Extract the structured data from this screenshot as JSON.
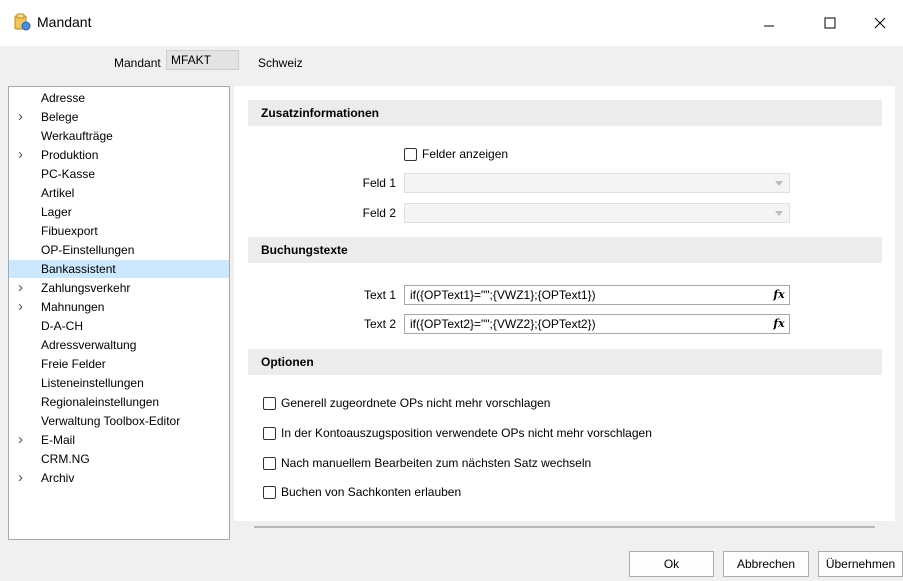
{
  "window": {
    "title": "Mandant"
  },
  "header": {
    "mandant_label": "Mandant",
    "mandant_code": "MFAKT",
    "mandant_name": "Schweiz"
  },
  "tree": {
    "items": [
      {
        "label": "Adresse",
        "expandable": false,
        "selected": false
      },
      {
        "label": "Belege",
        "expandable": true,
        "selected": false
      },
      {
        "label": "Werkaufträge",
        "expandable": false,
        "selected": false
      },
      {
        "label": "Produktion",
        "expandable": true,
        "selected": false
      },
      {
        "label": "PC-Kasse",
        "expandable": false,
        "selected": false
      },
      {
        "label": "Artikel",
        "expandable": false,
        "selected": false
      },
      {
        "label": "Lager",
        "expandable": false,
        "selected": false
      },
      {
        "label": "Fibuexport",
        "expandable": false,
        "selected": false
      },
      {
        "label": "OP-Einstellungen",
        "expandable": false,
        "selected": false
      },
      {
        "label": "Bankassistent",
        "expandable": false,
        "selected": true
      },
      {
        "label": "Zahlungsverkehr",
        "expandable": true,
        "selected": false
      },
      {
        "label": "Mahnungen",
        "expandable": true,
        "selected": false
      },
      {
        "label": "D-A-CH",
        "expandable": false,
        "selected": false
      },
      {
        "label": "Adressverwaltung",
        "expandable": false,
        "selected": false
      },
      {
        "label": "Freie Felder",
        "expandable": false,
        "selected": false
      },
      {
        "label": "Listeneinstellungen",
        "expandable": false,
        "selected": false
      },
      {
        "label": "Regionaleinstellungen",
        "expandable": false,
        "selected": false
      },
      {
        "label": "Verwaltung Toolbox-Editor",
        "expandable": false,
        "selected": false
      },
      {
        "label": "E-Mail",
        "expandable": true,
        "selected": false
      },
      {
        "label": "CRM.NG",
        "expandable": false,
        "selected": false
      },
      {
        "label": "Archiv",
        "expandable": true,
        "selected": false
      }
    ]
  },
  "zusatz": {
    "title": "Zusatzinformationen",
    "show_fields_label": "Felder anzeigen",
    "feld1_label": "Feld 1",
    "feld1_value": "",
    "feld2_label": "Feld 2",
    "feld2_value": ""
  },
  "buchung": {
    "title": "Buchungstexte",
    "text1_label": "Text 1",
    "text1_value": "if({OPText1}=\"\";{VWZ1};{OPText1})",
    "text2_label": "Text 2",
    "text2_value": "if({OPText2}=\"\";{VWZ2};{OPText2})",
    "fx_label": "fx"
  },
  "optionen": {
    "title": "Optionen",
    "items": [
      {
        "label": "Generell zugeordnete OPs nicht mehr vorschlagen",
        "checked": false
      },
      {
        "label": "In der Kontoauszugsposition verwendete OPs nicht mehr vorschlagen",
        "checked": false
      },
      {
        "label": "Nach manuellem Bearbeiten zum nächsten Satz wechseln",
        "checked": false
      },
      {
        "label": "Buchen von Sachkonten erlauben",
        "checked": false
      }
    ]
  },
  "buttons": {
    "ok": "Ok",
    "cancel": "Abbrechen",
    "apply": "Übernehmen"
  },
  "colors": {
    "selection": "#cce8ff",
    "section_bg": "#ececec",
    "app_icon": "#e8b040"
  }
}
